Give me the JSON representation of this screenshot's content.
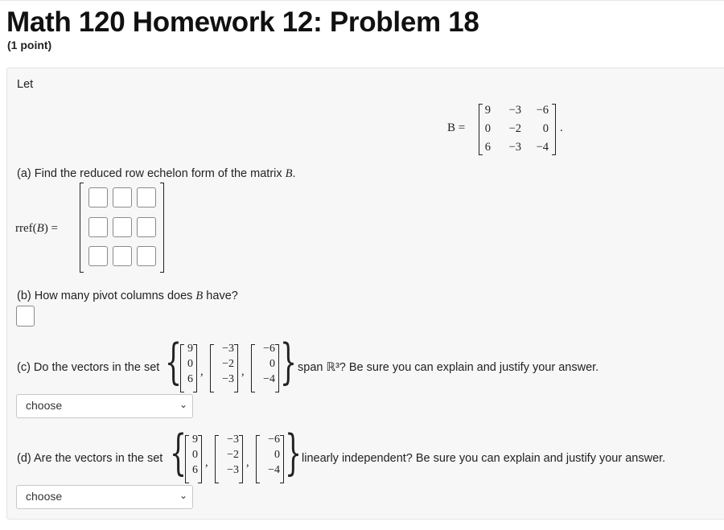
{
  "header": {
    "title": "Math 120 Homework 12: Problem 18",
    "points": "(1 point)"
  },
  "problem": {
    "let": "Let",
    "B_label": "B =",
    "B_matrix": [
      [
        "9",
        "−3",
        "−6"
      ],
      [
        "0",
        "−2",
        "0"
      ],
      [
        "6",
        "−3",
        "−4"
      ]
    ],
    "period": ".",
    "a": {
      "prefix": "(a) Find the reduced row echelon form of the matrix ",
      "var": "B",
      "suffix": ".",
      "rref_label": "rref(",
      "rref_var": "B",
      "rref_close": ") ="
    },
    "b": {
      "prefix": "(b) How many pivot columns does ",
      "var": "B",
      "suffix": " have?"
    },
    "c": {
      "prefix": "(c) Do the vectors in the set",
      "suffix": "span ℝ³? Be sure you can explain and justify your answer.",
      "select_value": "choose"
    },
    "d": {
      "prefix": "(d) Are the vectors in the set",
      "suffix": "linearly independent? Be sure you can explain and justify your answer.",
      "select_value": "choose"
    },
    "vectors": [
      [
        "9",
        "0",
        "6"
      ],
      [
        "−3",
        "−2",
        "−3"
      ],
      [
        "−6",
        "0",
        "−4"
      ]
    ],
    "comma": ","
  }
}
